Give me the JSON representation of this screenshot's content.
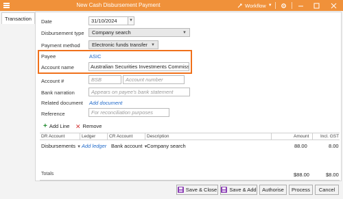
{
  "window": {
    "title": "New Cash Disbursement Payment",
    "workflow_label": "Workflow"
  },
  "tabs": [
    "Transaction"
  ],
  "form": {
    "date_label": "Date",
    "date_value": "31/10/2024",
    "disbursement_type_label": "Disbursement type",
    "disbursement_type_value": "Company search",
    "payment_method_label": "Payment method",
    "payment_method_value": "Electronic funds transfer",
    "payee_label": "Payee",
    "payee_value": "ASIC",
    "account_name_label": "Account name",
    "account_name_value": "Australian Securities Investments Commission",
    "account_no_label": "Account #",
    "bsb_placeholder": "BSB",
    "account_number_placeholder": "Account number",
    "bank_narration_label": "Bank narration",
    "bank_narration_placeholder": "Appears on payee's bank statement",
    "related_document_label": "Related document",
    "add_document_link": "Add document",
    "reference_label": "Reference",
    "reference_placeholder": "For reconciliation purposes"
  },
  "lines": {
    "add_line_label": "Add Line",
    "remove_label": "Remove",
    "columns": [
      "DR Account",
      "Ledger",
      "CR Account",
      "Description",
      "Amount",
      "Incl. GST"
    ],
    "rows": [
      {
        "dr_account": "Disbursements",
        "ledger": "Add ledger",
        "cr_account": "Bank account",
        "description": "Company search",
        "amount": "88.00",
        "incl_gst": "8.00"
      }
    ],
    "totals_label": "Totals",
    "total_amount": "$88.00",
    "total_gst": "$8.00"
  },
  "buttons": {
    "save_close": "Save & Close",
    "save_add": "Save & Add",
    "authorise": "Authorise",
    "process": "Process",
    "cancel": "Cancel"
  },
  "colors": {
    "titlebar": "#f0913a",
    "highlight": "#f0701a",
    "link": "#1e68c9",
    "save_icon": "#8b3fb4"
  }
}
